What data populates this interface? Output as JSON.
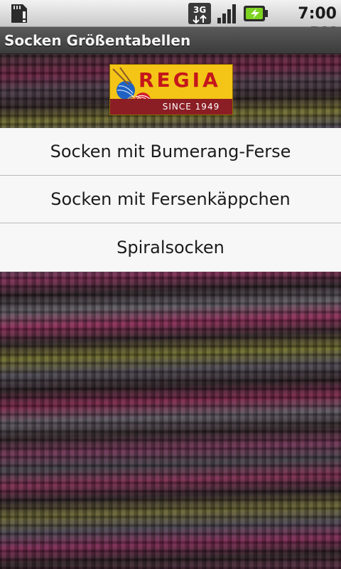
{
  "status_bar": {
    "time": "7:00 PM",
    "icons": [
      "sd-card-icon",
      "3g-icon",
      "signal-icon",
      "battery-charging-icon"
    ],
    "network_label": "3G"
  },
  "title_bar": {
    "title": "Socken Größentabellen"
  },
  "logo": {
    "brand": "REGIA",
    "since": "SINCE 1949",
    "colors": {
      "yellow": "#f4c516",
      "red": "#c4161c",
      "dark_red": "#8a1e24"
    }
  },
  "menu": {
    "items": [
      {
        "label": "Socken mit Bumerang-Ferse"
      },
      {
        "label": "Socken mit Fersenkäppchen"
      },
      {
        "label": "Spiralsocken"
      }
    ]
  }
}
